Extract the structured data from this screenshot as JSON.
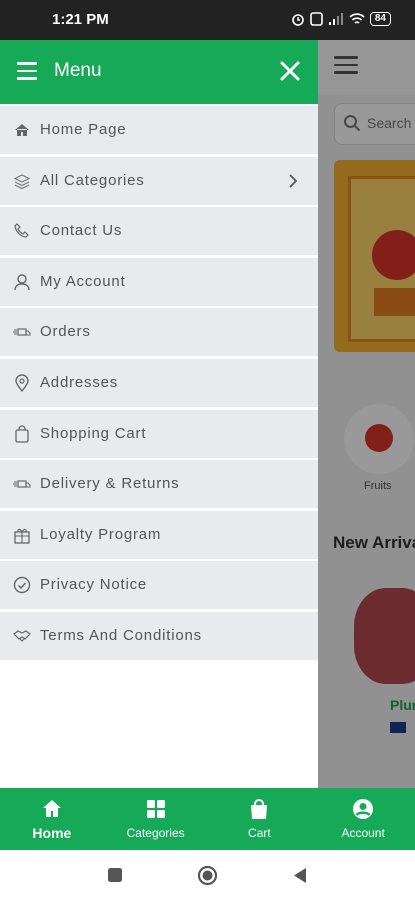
{
  "status_bar": {
    "time": "1:21 PM",
    "battery": "84"
  },
  "drawer": {
    "title": "Menu",
    "items": [
      {
        "label": "Home Page",
        "icon": "home-icon"
      },
      {
        "label": "All Categories",
        "icon": "layers-icon",
        "has_chevron": true
      },
      {
        "label": "Contact Us",
        "icon": "phone-icon"
      },
      {
        "label": "My Account",
        "icon": "user-icon"
      },
      {
        "label": "Orders",
        "icon": "delivery-truck-icon"
      },
      {
        "label": "Addresses",
        "icon": "location-pin-icon"
      },
      {
        "label": "Shopping Cart",
        "icon": "shopping-bag-icon"
      },
      {
        "label": "Delivery & Returns",
        "icon": "delivery-truck-icon"
      },
      {
        "label": "Loyalty Program",
        "icon": "gift-icon"
      },
      {
        "label": "Privacy Notice",
        "icon": "check-circle-icon"
      },
      {
        "label": "Terms And Conditions",
        "icon": "handshake-icon"
      }
    ]
  },
  "background": {
    "search_placeholder": "Search",
    "category_label": "Fruits",
    "section_title": "New Arrivals",
    "product_name": "Plum"
  },
  "bottom_nav": [
    {
      "label": "Home",
      "icon": "home-icon",
      "active": true
    },
    {
      "label": "Categories",
      "icon": "grid-icon",
      "active": false
    },
    {
      "label": "Cart",
      "icon": "shopping-bag-icon",
      "active": false
    },
    {
      "label": "Account",
      "icon": "account-circle-icon",
      "active": false
    }
  ],
  "colors": {
    "brand_green": "#16a958",
    "menu_item_bg": "#e8eaed",
    "status_bar_bg": "#222222"
  }
}
